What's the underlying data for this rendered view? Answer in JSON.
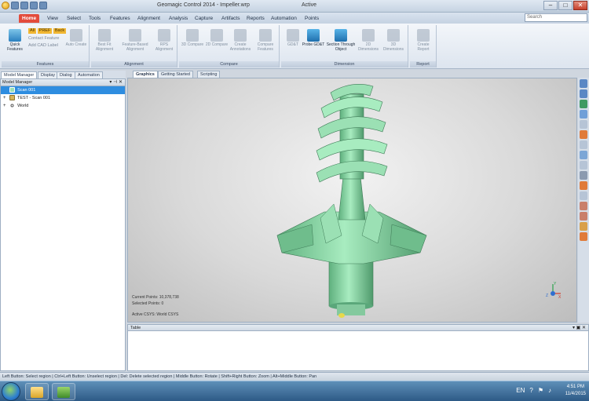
{
  "window": {
    "title": "Geomagic Control 2014 - Impeller.wrp",
    "status": "Active",
    "controls": [
      "–",
      "□",
      "✕"
    ]
  },
  "menu": {
    "tabs": [
      "Home",
      "View",
      "Select",
      "Tools",
      "Features",
      "Alignment",
      "Analysis",
      "Capture",
      "Artifacts",
      "Reports",
      "Automation",
      "Points"
    ],
    "active_tab": "Home",
    "search_placeholder": "Search"
  },
  "ribbon": {
    "features_group": {
      "label": "Features",
      "quick_features": "Quick Features",
      "quick_features_l1": "Quick",
      "quick_features_l2": "Features",
      "chips": [
        "All",
        "PREF",
        "Back"
      ],
      "opt1": "Contact Feature",
      "opt2": "Add CAD Label",
      "auto_create": "Auto Create"
    },
    "alignment_group": {
      "label": "Alignment",
      "buttons": [
        "Best Fit Alignment",
        "Feature-Based Alignment",
        "RPS Alignment"
      ]
    },
    "compare_group": {
      "label": "Compare",
      "buttons": [
        "3D Compare",
        "2D Compare",
        "Create Annotations",
        "Compare Features"
      ]
    },
    "dimension_group": {
      "label": "Dimension",
      "buttons": [
        "GD&T",
        "Probe GD&T",
        "Section Through Object",
        "2D Dimensions",
        "3D Dimensions"
      ]
    },
    "report_group": {
      "label": "Report",
      "buttons": [
        "Create Report"
      ]
    }
  },
  "left_panel": {
    "tabs": [
      "Model Manager",
      "Display",
      "Dialog",
      "Automation"
    ],
    "header": "Model Manager",
    "items": [
      {
        "label": "Scan 001",
        "selected": true
      },
      {
        "label": "TEST - Scan 001",
        "selected": false
      },
      {
        "label": "World",
        "selected": false
      }
    ]
  },
  "graphics": {
    "tabs": [
      "Graphics",
      "Getting Started",
      "Scripting"
    ],
    "current_points": "Current Points: 10,378,738",
    "selected_points": "Selected Points: 0",
    "active_csys": "Active CSYS: World CSYS",
    "axis_labels": {
      "y": "Y",
      "x": "X",
      "z": "Z"
    }
  },
  "table_panel": {
    "title": "Table",
    "controls": "▾ ▣ ✕"
  },
  "status_bar": {
    "text": "Left Button: Select region | Ctrl+Left Button: Unselect region | Del: Delete selected region | Middle Button: Rotate | Shift+Right Button: Zoom | Alt+Middle Button: Pan"
  },
  "taskbar": {
    "time": "4:51 PM",
    "date": "11/4/2015",
    "lang": "EN"
  },
  "colors": {
    "accent_tab": "#e34b3b",
    "selection": "#2e8de0",
    "model_green": "#8ed6a6"
  }
}
